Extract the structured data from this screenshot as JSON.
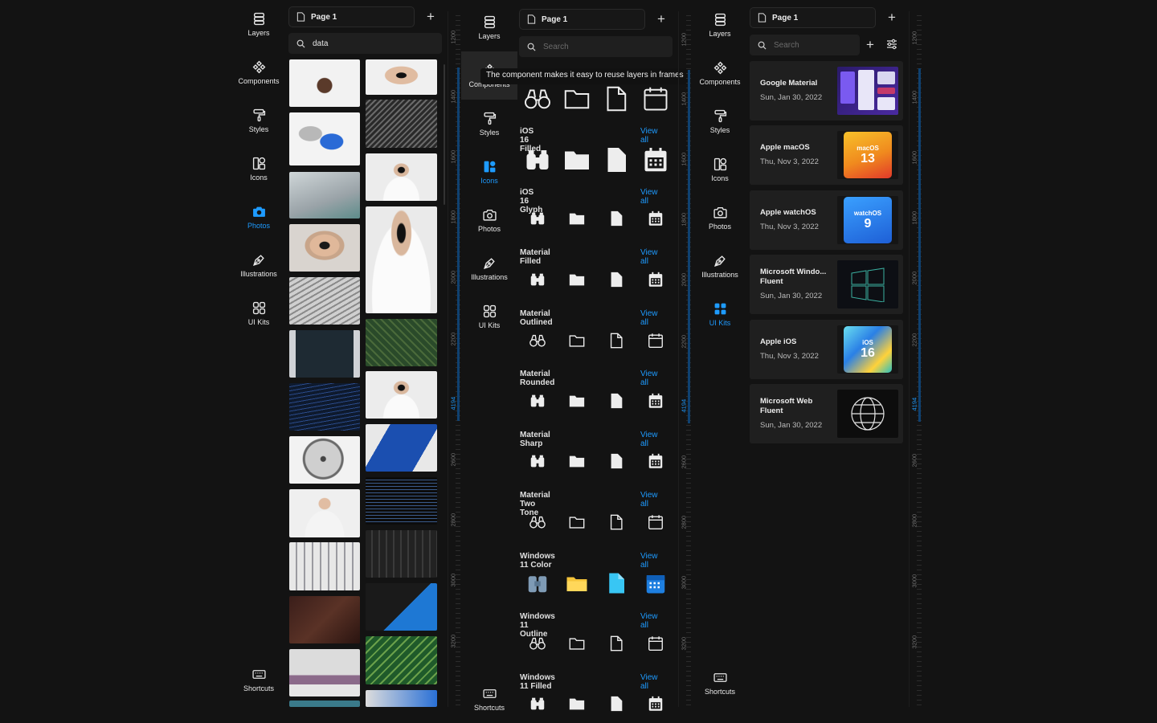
{
  "nav": {
    "layers": "Layers",
    "components": "Components",
    "styles": "Styles",
    "icons": "Icons",
    "photos": "Photos",
    "illustrations": "Illustrations",
    "ui_kits": "UI Kits",
    "shortcuts": "Shortcuts"
  },
  "page_tab": "Page 1",
  "panel1": {
    "search_value": "data",
    "active": "Photos"
  },
  "panel2": {
    "search_placeholder": "Search",
    "active": "Icons",
    "tooltip": "The component makes it easy to reuse layers in frames",
    "view_all": "View all",
    "icon_sets": [
      "iOS 16 Filled",
      "iOS 16 Glyph",
      "Material Filled",
      "Material Outlined",
      "Material Rounded",
      "Material Sharp",
      "Material Two Tone",
      "Windows 11 Color",
      "Windows 11 Outline",
      "Windows 11 Filled"
    ]
  },
  "panel3": {
    "search_placeholder": "Search",
    "active": "UI Kits",
    "kits": [
      {
        "name": "Google Material",
        "date": "Sun, Jan 30, 2022",
        "thumb": "material"
      },
      {
        "name": "Apple macOS",
        "date": "Thu, Nov 3, 2022",
        "thumb": "macos",
        "badge": "macOS",
        "num": "13"
      },
      {
        "name": "Apple watchOS",
        "date": "Thu, Nov 3, 2022",
        "thumb": "watchos",
        "badge": "watchOS",
        "num": "9"
      },
      {
        "name": "Microsoft Windo... Fluent",
        "date": "Sun, Jan 30, 2022",
        "thumb": "windows"
      },
      {
        "name": "Apple iOS",
        "date": "Thu, Nov 3, 2022",
        "thumb": "ios",
        "badge": "iOS",
        "num": "16"
      },
      {
        "name": "Microsoft Web Fluent",
        "date": "Sun, Jan 30, 2022",
        "thumb": "globe"
      }
    ]
  },
  "ruler": [
    "1200",
    "1400",
    "1600",
    "1800",
    "2000",
    "2200",
    "4194",
    "2600",
    "2800",
    "3000",
    "3200"
  ],
  "colors": {
    "accent": "#1e9bff",
    "background": "#131313",
    "card": "#1f1f1f"
  }
}
